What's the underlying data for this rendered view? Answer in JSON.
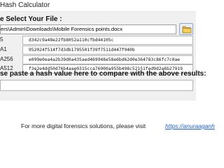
{
  "window": {
    "title": "Hash Calculator"
  },
  "file_select": {
    "label": "e Select Your File :",
    "path": "ers\\Admin\\Downloads\\Mobile Forensics points.docx",
    "browse_icon": "folder-icon"
  },
  "hashes": [
    {
      "label": "5",
      "value": "d342c9a48e22fb8052a110cfbd44105c"
    },
    {
      "label": "A1",
      "value": "952024f514f7d3db1795501f39f7511d447f940b"
    },
    {
      "label": "A256",
      "value": "e099e0ea4a2b39d0a435aed469948e58e6bd62d0e364783c86fc7c0ae"
    },
    {
      "label": "A512",
      "value": "f3e2e4dd50d76b4aae0315cca76900a955b498c52151fed9d2a6b27919"
    }
  ],
  "compare": {
    "label": "se paste a hash value here to compare with the above results:",
    "value": ""
  },
  "footer": {
    "text": "For more digital forensics solutions, please visit",
    "link": "https://anuraaganh"
  },
  "colors": {
    "panel_bg": "#f0f0f0",
    "link": "#1a5fd6",
    "folder": "#e8b740"
  }
}
